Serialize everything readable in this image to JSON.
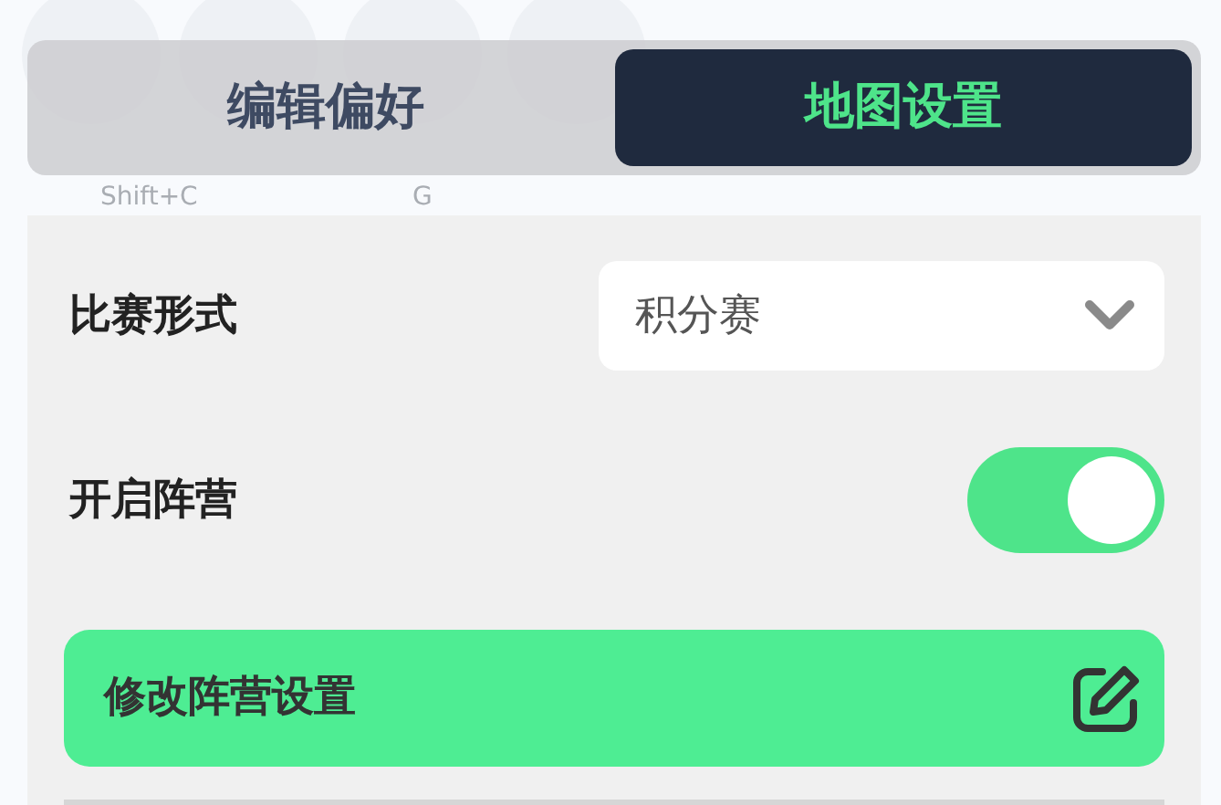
{
  "background_shortcuts": [
    "Shift+C",
    "G"
  ],
  "tabs": [
    {
      "label": "编辑偏好",
      "selected": false
    },
    {
      "label": "地图设置",
      "selected": true
    }
  ],
  "settings": [
    {
      "kind": "dropdown",
      "label": "比赛形式",
      "value": "积分赛"
    },
    {
      "kind": "toggle",
      "label": "开启阵营",
      "on": true
    }
  ],
  "action_button": {
    "label": "修改阵营设置"
  }
}
